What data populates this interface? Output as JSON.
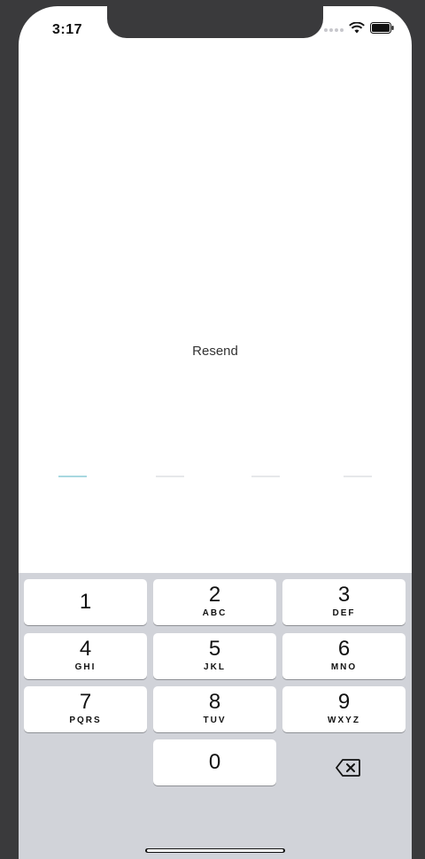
{
  "status_bar": {
    "time": "3:17"
  },
  "main": {
    "resend_label": "Resend"
  },
  "keypad": {
    "keys": [
      {
        "num": "1",
        "letters": ""
      },
      {
        "num": "2",
        "letters": "ABC"
      },
      {
        "num": "3",
        "letters": "DEF"
      },
      {
        "num": "4",
        "letters": "GHI"
      },
      {
        "num": "5",
        "letters": "JKL"
      },
      {
        "num": "6",
        "letters": "MNO"
      },
      {
        "num": "7",
        "letters": "PQRS"
      },
      {
        "num": "8",
        "letters": "TUV"
      },
      {
        "num": "9",
        "letters": "WXYZ"
      },
      {
        "num": "0",
        "letters": ""
      }
    ]
  },
  "colors": {
    "otp_active": "#a8d8e0",
    "otp_inactive": "#e6e8ea",
    "keyboard_bg": "#d1d3d9"
  }
}
